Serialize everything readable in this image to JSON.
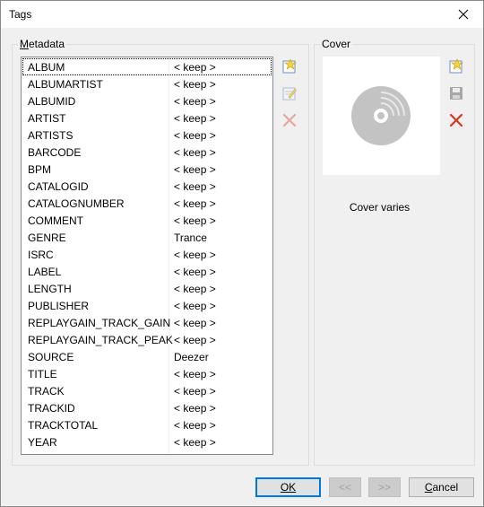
{
  "window": {
    "title": "Tags"
  },
  "metadata": {
    "group_label": "Metadata",
    "rows": [
      {
        "key": "ALBUM",
        "value": "< keep >"
      },
      {
        "key": "ALBUMARTIST",
        "value": "< keep >"
      },
      {
        "key": "ALBUMID",
        "value": "< keep >"
      },
      {
        "key": "ARTIST",
        "value": "< keep >"
      },
      {
        "key": "ARTISTS",
        "value": "< keep >"
      },
      {
        "key": "BARCODE",
        "value": "< keep >"
      },
      {
        "key": "BPM",
        "value": "< keep >"
      },
      {
        "key": "CATALOGID",
        "value": "< keep >"
      },
      {
        "key": "CATALOGNUMBER",
        "value": "< keep >"
      },
      {
        "key": "COMMENT",
        "value": "< keep >"
      },
      {
        "key": "GENRE",
        "value": "Trance"
      },
      {
        "key": "ISRC",
        "value": "< keep >"
      },
      {
        "key": "LABEL",
        "value": "< keep >"
      },
      {
        "key": "LENGTH",
        "value": "< keep >"
      },
      {
        "key": "PUBLISHER",
        "value": "< keep >"
      },
      {
        "key": "REPLAYGAIN_TRACK_GAIN",
        "value": "< keep >"
      },
      {
        "key": "REPLAYGAIN_TRACK_PEAK",
        "value": "< keep >"
      },
      {
        "key": "SOURCE",
        "value": "Deezer"
      },
      {
        "key": "TITLE",
        "value": "< keep >"
      },
      {
        "key": "TRACK",
        "value": "< keep >"
      },
      {
        "key": "TRACKID",
        "value": "< keep >"
      },
      {
        "key": "TRACKTOTAL",
        "value": "< keep >"
      },
      {
        "key": "YEAR",
        "value": "< keep >"
      }
    ],
    "selected_index": 0,
    "tools": [
      "add-tag-icon",
      "edit-tag-icon",
      "delete-tag-icon"
    ]
  },
  "cover": {
    "group_label": "Cover",
    "status_text": "Cover varies",
    "tools": [
      "add-cover-icon",
      "save-cover-icon",
      "delete-cover-icon"
    ]
  },
  "buttons": {
    "ok": "OK",
    "prev": "<<",
    "next": ">>",
    "cancel": "Cancel"
  },
  "colors": {
    "accent": "#0078d7",
    "delete_red": "#d9381e"
  }
}
